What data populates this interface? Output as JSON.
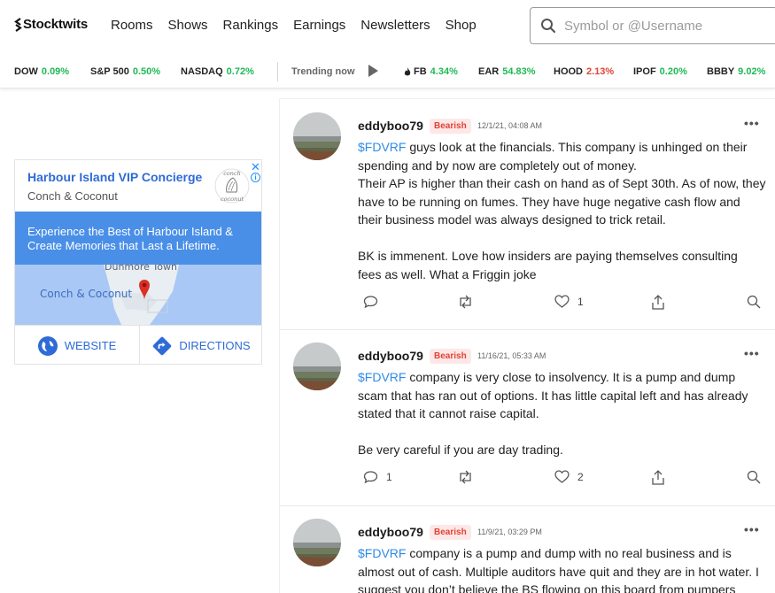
{
  "header": {
    "logo_text": "Stocktwits",
    "nav": [
      "Rooms",
      "Shows",
      "Rankings",
      "Earnings",
      "Newsletters",
      "Shop"
    ],
    "search_placeholder": "Symbol or @Username"
  },
  "ticker": {
    "indices": [
      {
        "symbol": "DOW",
        "change": "0.09%",
        "direction": "up"
      },
      {
        "symbol": "S&P 500",
        "change": "0.50%",
        "direction": "up"
      },
      {
        "symbol": "NASDAQ",
        "change": "0.72%",
        "direction": "up"
      }
    ],
    "trending_label": "Trending now",
    "trending": [
      {
        "symbol": "FB",
        "change": "4.34%",
        "direction": "up",
        "icon": "flame-icon"
      },
      {
        "symbol": "EAR",
        "change": "54.83%",
        "direction": "up"
      },
      {
        "symbol": "HOOD",
        "change": "2.13%",
        "direction": "down"
      },
      {
        "symbol": "IPOF",
        "change": "0.20%",
        "direction": "up"
      },
      {
        "symbol": "BBBY",
        "change": "9.02%",
        "direction": "up"
      }
    ],
    "colors": {
      "up": "#1db954",
      "down": "#e34234"
    }
  },
  "ad": {
    "title": "Harbour Island VIP Concierge",
    "subtitle": "Conch & Coconut",
    "logo_text_top": "conch",
    "logo_text_bottom": "coconut",
    "close_glyph": "✕",
    "info_glyph": "i",
    "banner_lines": [
      "Experience the Best of Harbour Island &",
      "Create Memories that Last a Lifetime."
    ],
    "map_label_place": "Dunmore Town",
    "map_label_pin": "Conch & Coconut",
    "website_label": "WEBSITE",
    "directions_label": "DIRECTIONS"
  },
  "posts": [
    {
      "username": "eddyboo79",
      "sentiment": "Bearish",
      "timestamp": "12/1/21, 04:08 AM",
      "cashtag": "$FDVRF",
      "lines": [
        " guys look at the financials.  This company is unhinged on their",
        "spending and by now are completely out of money.",
        "Their AP is higher than their cash on hand as of Sept 30th. As of now, they",
        "have to be running on fumes.  They have huge negative cash flow and",
        "their business model was always designed to trick retail.",
        "",
        "BK is immenent.  Love how insiders are paying themselves consulting",
        "fees as well.   What a Friggin joke"
      ],
      "comments": "",
      "likes": "1"
    },
    {
      "username": "eddyboo79",
      "sentiment": "Bearish",
      "timestamp": "11/16/21, 05:33 AM",
      "cashtag": "$FDVRF",
      "lines": [
        " company is very close to insolvency.  It is a pump and dump",
        "scam that has ran out of options.   It has little capital left and has already",
        "stated that it cannot raise capital.",
        "",
        "Be very careful if you are day trading."
      ],
      "comments": "1",
      "likes": "2"
    },
    {
      "username": "eddyboo79",
      "sentiment": "Bearish",
      "timestamp": "11/9/21, 03:29 PM",
      "cashtag": "$FDVRF",
      "lines": [
        " company is a pump and dump with no real business and is",
        "almost out of cash. Multiple auditors have quit and they are in hot water. I",
        "suggest you don’t believe the BS flowing on this board from pumpers"
      ],
      "comments": "",
      "likes": ""
    }
  ]
}
